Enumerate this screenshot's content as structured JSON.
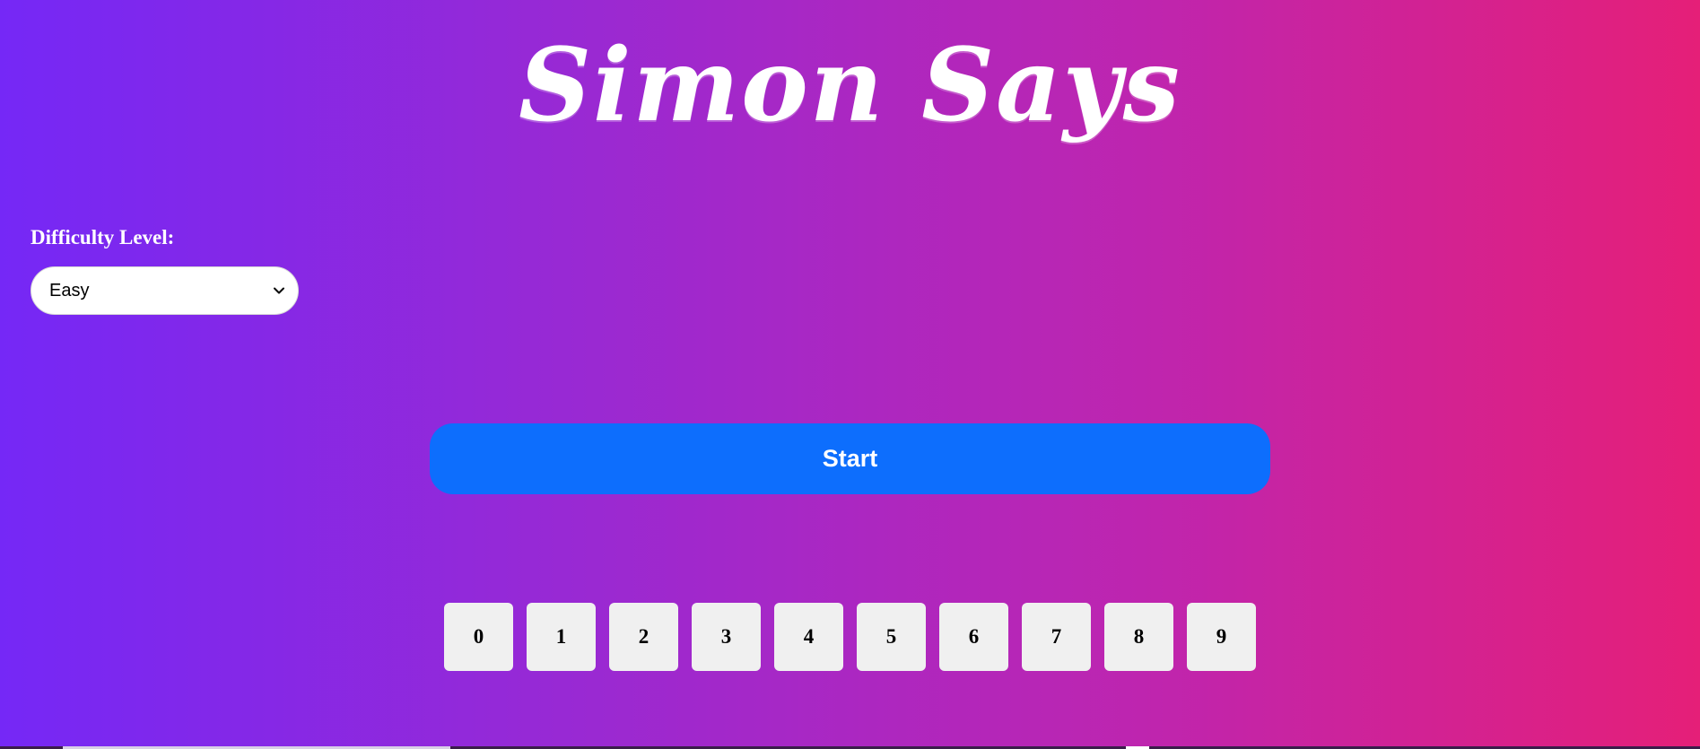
{
  "header": {
    "title": "Simon Says"
  },
  "difficulty": {
    "label": "Difficulty Level:",
    "selected": "Easy"
  },
  "controls": {
    "start_label": "Start"
  },
  "keypad": {
    "keys": [
      "0",
      "1",
      "2",
      "3",
      "4",
      "5",
      "6",
      "7",
      "8",
      "9"
    ]
  },
  "colors": {
    "gradient_start": "#7528f6",
    "gradient_end": "#e51f78",
    "start_button": "#0d6efd",
    "key_background": "#f0f0f0"
  },
  "icons": {
    "select_arrow": "chevron-down-icon"
  }
}
